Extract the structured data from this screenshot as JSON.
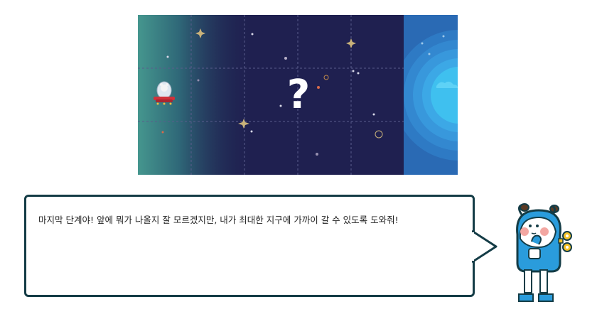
{
  "game": {
    "mystery_symbol": "?",
    "dialog": "마지막 단계야! 앞에 뭐가 나올지 잘 모르겠지만, 내가 최대한 지구에 가까이 갈 수 있도록 도와줘!"
  },
  "colors": {
    "space": "#1f2050",
    "grid_line": "#5a5c8c",
    "left_gradient_start": "#45968e",
    "earth_core": "#3fc0ef",
    "bubble_border": "#143c46",
    "robot_blue": "#2a9cdc",
    "robot_yellow": "#f3c227"
  },
  "icons": {
    "ufo": "ufo-spaceship-icon",
    "earth": "earth-planet-icon",
    "mascot": "robot-mascot-icon"
  }
}
